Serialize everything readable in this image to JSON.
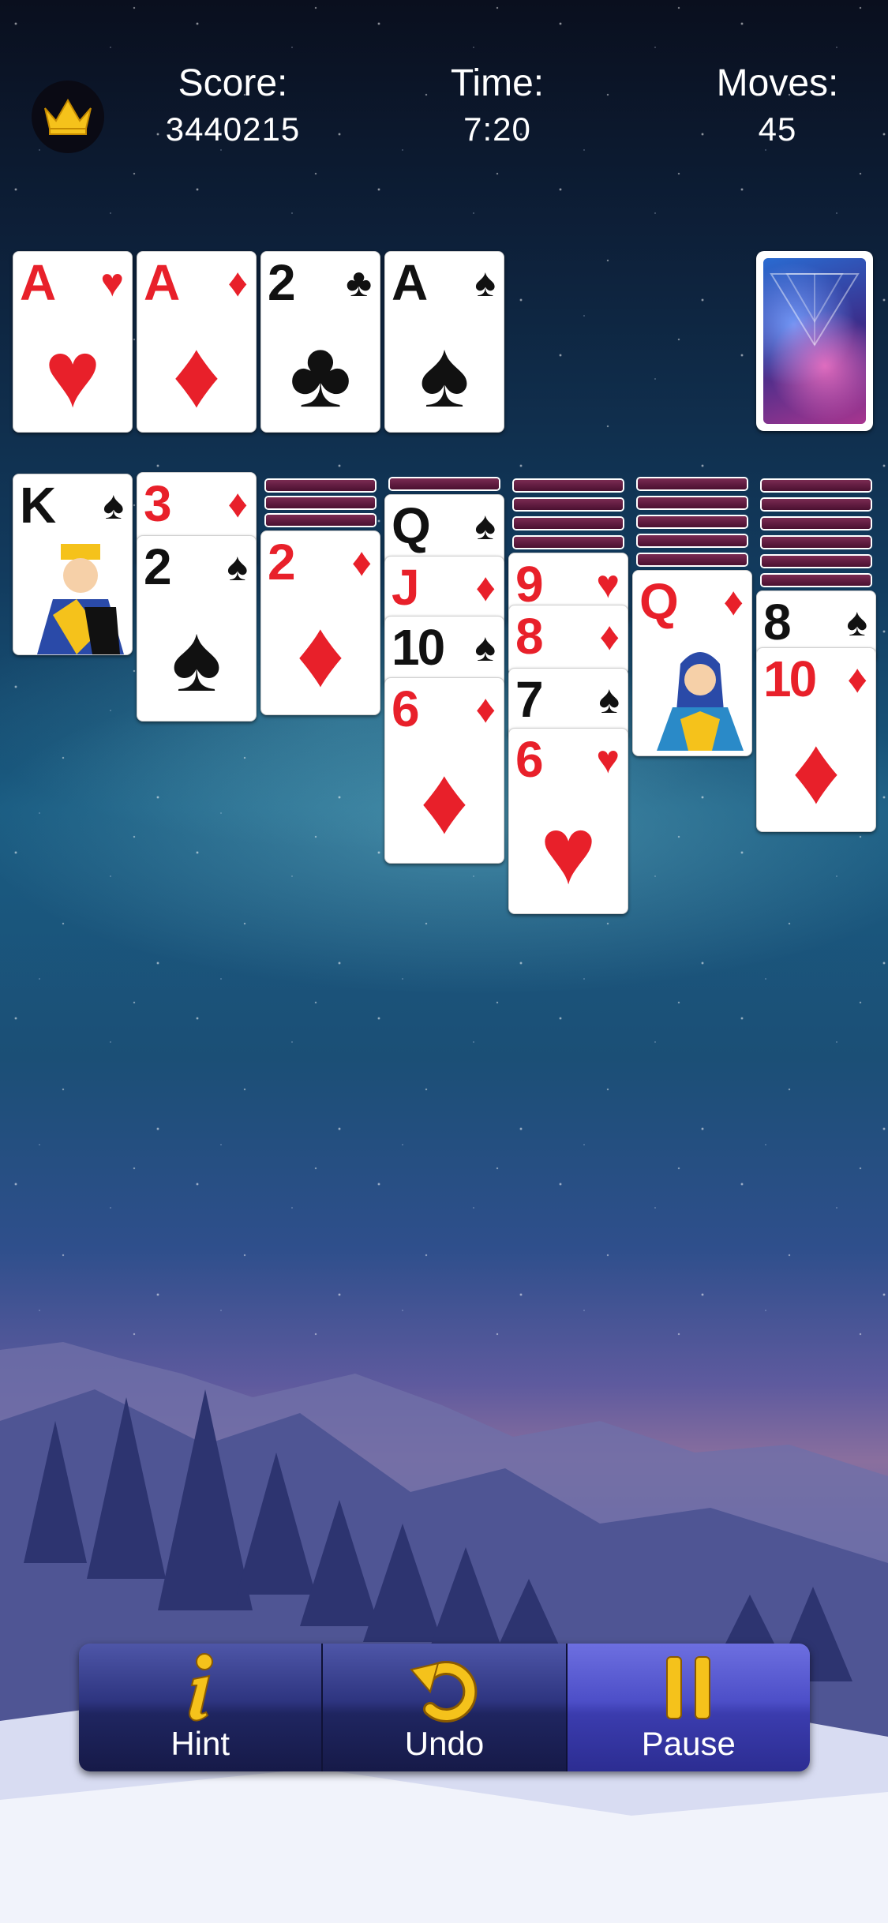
{
  "header": {
    "crown_icon": "crown-icon",
    "score_label": "Score:",
    "score_value": "3440215",
    "time_label": "Time:",
    "time_value": "7:20",
    "moves_label": "Moves:",
    "moves_value": "45"
  },
  "foundations": [
    {
      "rank": "A",
      "suit": "♥",
      "color": "red"
    },
    {
      "rank": "A",
      "suit": "♦",
      "color": "red"
    },
    {
      "rank": "2",
      "suit": "♣",
      "color": "black"
    },
    {
      "rank": "A",
      "suit": "♠",
      "color": "black"
    }
  ],
  "stock": {
    "state": "face-down"
  },
  "tableau": [
    {
      "hidden": 0,
      "cards": [
        {
          "rank": "K",
          "suit": "♠",
          "color": "black"
        }
      ]
    },
    {
      "hidden": 0,
      "cards": [
        {
          "rank": "3",
          "suit": "♦",
          "color": "red"
        },
        {
          "rank": "2",
          "suit": "♠",
          "color": "black"
        }
      ]
    },
    {
      "hidden": 3,
      "cards": [
        {
          "rank": "2",
          "suit": "♦",
          "color": "red"
        }
      ]
    },
    {
      "hidden": 1,
      "cards": [
        {
          "rank": "Q",
          "suit": "♠",
          "color": "black"
        },
        {
          "rank": "J",
          "suit": "♦",
          "color": "red"
        },
        {
          "rank": "10",
          "suit": "♠",
          "color": "black"
        },
        {
          "rank": "6",
          "suit": "♦",
          "color": "red"
        }
      ]
    },
    {
      "hidden": 4,
      "cards": [
        {
          "rank": "9",
          "suit": "♥",
          "color": "red"
        },
        {
          "rank": "8",
          "suit": "♦",
          "color": "red"
        },
        {
          "rank": "7",
          "suit": "♠",
          "color": "black"
        },
        {
          "rank": "6",
          "suit": "♥",
          "color": "red"
        }
      ]
    },
    {
      "hidden": 5,
      "cards": [
        {
          "rank": "Q",
          "suit": "♦",
          "color": "red"
        }
      ]
    },
    {
      "hidden": 6,
      "cards": [
        {
          "rank": "8",
          "suit": "♠",
          "color": "black"
        },
        {
          "rank": "10",
          "suit": "♦",
          "color": "red"
        }
      ]
    }
  ],
  "toolbar": {
    "hint_label": "Hint",
    "undo_label": "Undo",
    "pause_label": "Pause"
  },
  "colors": {
    "red_suit": "#e8202a",
    "black_suit": "#111111",
    "card_back": "#5a1a3c",
    "toolbar_active": "#4d4fc8"
  }
}
